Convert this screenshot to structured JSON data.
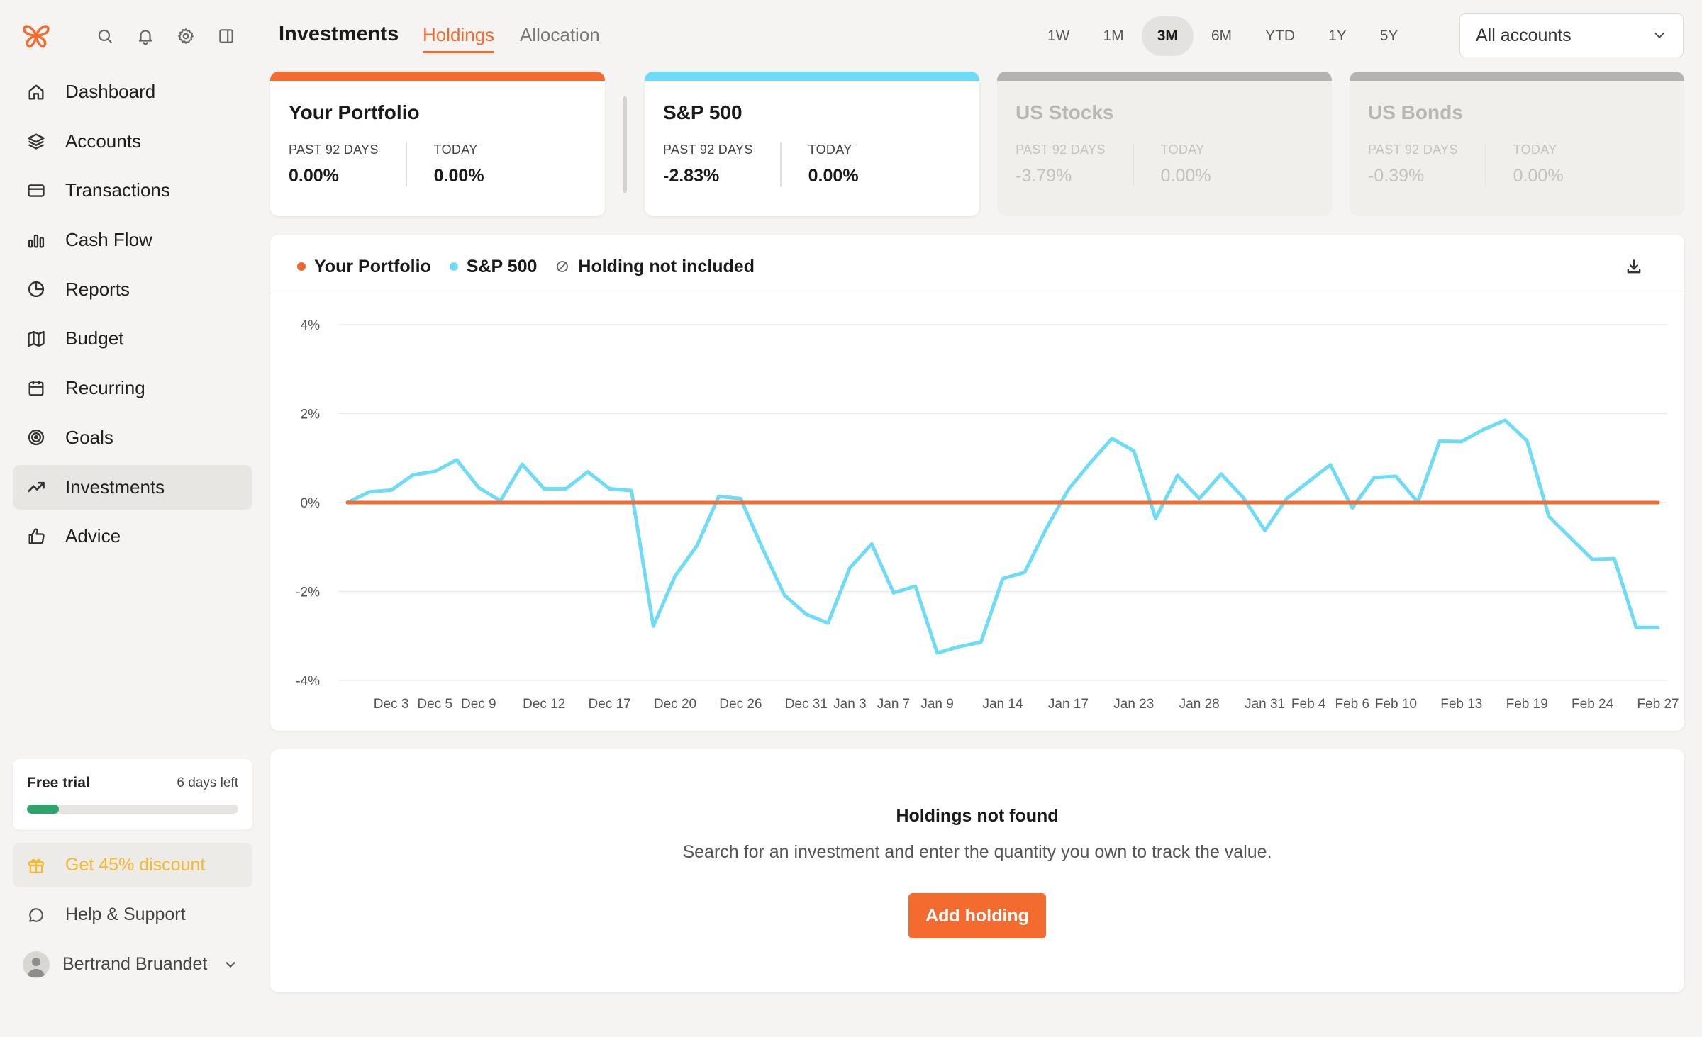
{
  "sidebar": {
    "items": [
      {
        "label": "Dashboard",
        "icon": "home-icon"
      },
      {
        "label": "Accounts",
        "icon": "layers-icon"
      },
      {
        "label": "Transactions",
        "icon": "credit-card-icon"
      },
      {
        "label": "Cash Flow",
        "icon": "bar-chart-icon"
      },
      {
        "label": "Reports",
        "icon": "pie-chart-icon"
      },
      {
        "label": "Budget",
        "icon": "map-icon"
      },
      {
        "label": "Recurring",
        "icon": "calendar-icon"
      },
      {
        "label": "Goals",
        "icon": "target-icon"
      },
      {
        "label": "Investments",
        "icon": "trending-up-icon",
        "active": true
      },
      {
        "label": "Advice",
        "icon": "thumbs-up-icon"
      }
    ],
    "trial": {
      "title": "Free trial",
      "days_left": "6 days left",
      "progress": 0.15
    },
    "discount_label": "Get 45% discount",
    "help_label": "Help & Support",
    "user_name": "Bertrand Bruandet"
  },
  "header": {
    "title": "Investments",
    "tabs": [
      {
        "label": "Holdings",
        "active": true
      },
      {
        "label": "Allocation",
        "active": false
      }
    ],
    "ranges": [
      "1W",
      "1M",
      "3M",
      "6M",
      "YTD",
      "1Y",
      "5Y"
    ],
    "active_range": "3M",
    "account_select": "All accounts"
  },
  "cards": [
    {
      "title": "Your Portfolio",
      "stats": [
        {
          "label": "PAST 92 DAYS",
          "value": "0.00%"
        },
        {
          "label": "TODAY",
          "value": "0.00%"
        }
      ],
      "color": "#f36b2e",
      "dim": false
    },
    {
      "title": "S&P 500",
      "stats": [
        {
          "label": "PAST 92 DAYS",
          "value": "-2.83%"
        },
        {
          "label": "TODAY",
          "value": "0.00%"
        }
      ],
      "color": "#6fdcf7",
      "dim": false
    },
    {
      "title": "US Stocks",
      "stats": [
        {
          "label": "PAST 92 DAYS",
          "value": "-3.79%"
        },
        {
          "label": "TODAY",
          "value": "0.00%"
        }
      ],
      "color": "#b5b3b0",
      "dim": true
    },
    {
      "title": "US Bonds",
      "stats": [
        {
          "label": "PAST 92 DAYS",
          "value": "-0.39%"
        },
        {
          "label": "TODAY",
          "value": "0.00%"
        }
      ],
      "color": "#b5b3b0",
      "dim": true
    }
  ],
  "legend": {
    "portfolio": "Your Portfolio",
    "sp500": "S&P 500",
    "not_included": "Holding not included"
  },
  "chart_data": {
    "type": "line",
    "ylim": [
      -4,
      4
    ],
    "yticks": [
      4,
      2,
      0,
      -2,
      -4
    ],
    "ytick_labels": [
      "4%",
      "2%",
      "0%",
      "-2%",
      "-4%"
    ],
    "xticks": [
      {
        "i": 2,
        "label": "Dec 3"
      },
      {
        "i": 4,
        "label": "Dec 5"
      },
      {
        "i": 6,
        "label": "Dec 9"
      },
      {
        "i": 9,
        "label": "Dec 12"
      },
      {
        "i": 12,
        "label": "Dec 17"
      },
      {
        "i": 15,
        "label": "Dec 20"
      },
      {
        "i": 18,
        "label": "Dec 26"
      },
      {
        "i": 21,
        "label": "Dec 31"
      },
      {
        "i": 23,
        "label": "Jan 3"
      },
      {
        "i": 25,
        "label": "Jan 7"
      },
      {
        "i": 27,
        "label": "Jan 9"
      },
      {
        "i": 30,
        "label": "Jan 14"
      },
      {
        "i": 33,
        "label": "Jan 17"
      },
      {
        "i": 36,
        "label": "Jan 23"
      },
      {
        "i": 39,
        "label": "Jan 28"
      },
      {
        "i": 42,
        "label": "Jan 31"
      },
      {
        "i": 44,
        "label": "Feb 4"
      },
      {
        "i": 46,
        "label": "Feb 6"
      },
      {
        "i": 48,
        "label": "Feb 10"
      },
      {
        "i": 51,
        "label": "Feb 13"
      },
      {
        "i": 54,
        "label": "Feb 19"
      },
      {
        "i": 57,
        "label": "Feb 24"
      },
      {
        "i": 60,
        "label": "Feb 27"
      }
    ],
    "series": [
      {
        "name": "Your Portfolio",
        "color": "#f36b2e",
        "values": [
          0,
          0,
          0,
          0,
          0,
          0,
          0,
          0,
          0,
          0,
          0,
          0,
          0,
          0,
          0,
          0,
          0,
          0,
          0,
          0,
          0,
          0,
          0,
          0,
          0,
          0,
          0,
          0,
          0,
          0,
          0,
          0,
          0,
          0,
          0,
          0,
          0,
          0,
          0,
          0,
          0,
          0,
          0,
          0,
          0,
          0,
          0,
          0,
          0,
          0,
          0,
          0,
          0,
          0,
          0,
          0,
          0,
          0,
          0,
          0,
          0
        ]
      },
      {
        "name": "S&P 500",
        "color": "#6fdcf7",
        "values": [
          0,
          0.24,
          0.28,
          0.62,
          0.7,
          0.96,
          0.34,
          0.04,
          0.86,
          0.31,
          0.31,
          0.69,
          0.31,
          0.27,
          -2.78,
          -1.65,
          -0.97,
          0.14,
          0.09,
          -1.03,
          -2.08,
          -2.51,
          -2.71,
          -1.47,
          -0.93,
          -2.03,
          -1.88,
          -3.38,
          -3.24,
          -3.14,
          -1.71,
          -1.57,
          -0.58,
          0.29,
          0.89,
          1.44,
          1.16,
          -0.36,
          0.61,
          0.09,
          0.64,
          0.12,
          -0.63,
          0.09,
          0.47,
          0.85,
          -0.12,
          0.56,
          0.59,
          0.01,
          1.38,
          1.37,
          1.64,
          1.85,
          1.39,
          -0.31,
          -0.8,
          -1.28,
          -1.26,
          -2.81,
          -2.81
        ]
      }
    ]
  },
  "empty": {
    "title": "Holdings not found",
    "description": "Search for an investment and enter the quantity you own to track the value.",
    "button": "Add holding"
  }
}
